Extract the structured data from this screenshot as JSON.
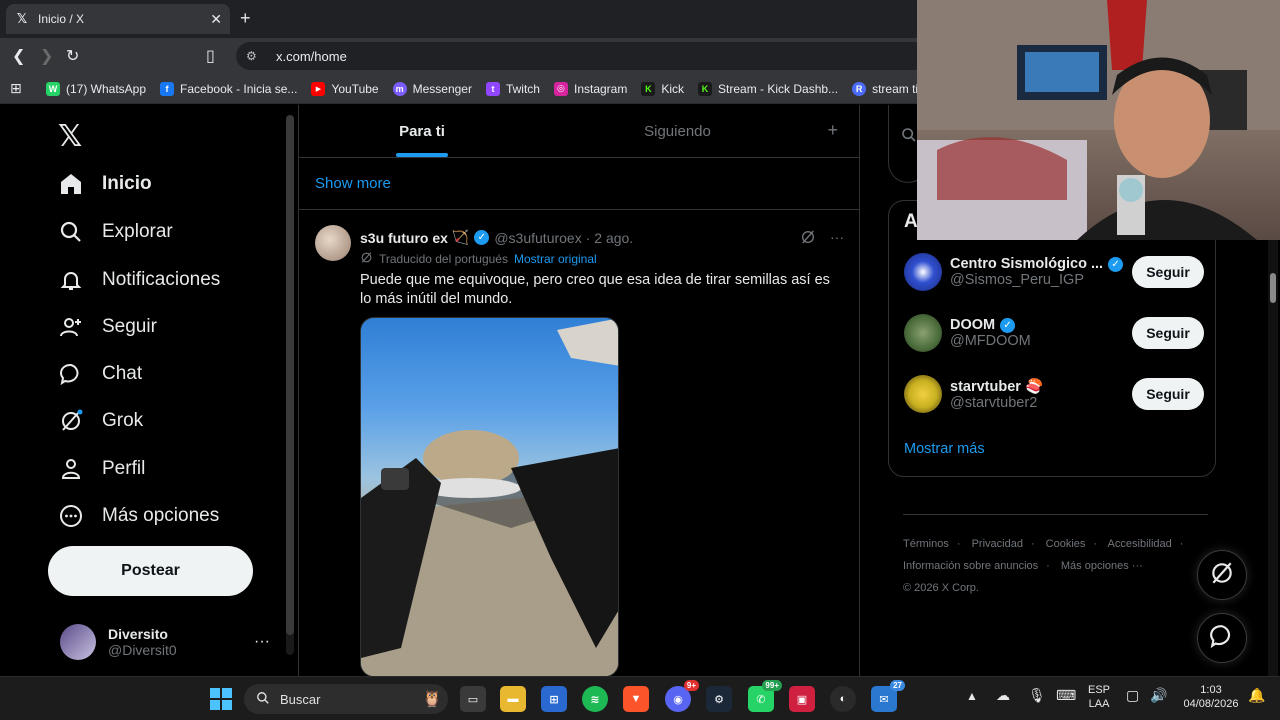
{
  "browser": {
    "tab_title": "Inicio / X",
    "tab_close": "✕",
    "new_tab": "+",
    "url": "x.com/home",
    "bookmarks": [
      {
        "label": "(17) WhatsApp",
        "color": "#25d366",
        "glyph": "W"
      },
      {
        "label": "Facebook - Inicia se...",
        "color": "#1877f2",
        "glyph": "f"
      },
      {
        "label": "YouTube",
        "color": "#ff0000",
        "glyph": "▶"
      },
      {
        "label": "Messenger",
        "color": "#7b5cff",
        "glyph": "m"
      },
      {
        "label": "Twitch",
        "color": "#9146ff",
        "glyph": "t"
      },
      {
        "label": "Instagram",
        "color": "#d6249f",
        "glyph": "◎"
      },
      {
        "label": "Kick",
        "color": "#53fc18",
        "glyph": "K"
      },
      {
        "label": "Stream - Kick Dashb...",
        "color": "#53fc18",
        "glyph": "K"
      },
      {
        "label": "stream tiktok",
        "color": "#4b6bfb",
        "glyph": "R"
      }
    ]
  },
  "nav": {
    "items": [
      {
        "label": "Inicio",
        "icon": "home-icon"
      },
      {
        "label": "Explorar",
        "icon": "search-icon"
      },
      {
        "label": "Notificaciones",
        "icon": "bell-icon"
      },
      {
        "label": "Seguir",
        "icon": "follow-icon"
      },
      {
        "label": "Chat",
        "icon": "chat-icon"
      },
      {
        "label": "Grok",
        "icon": "grok-icon"
      },
      {
        "label": "Perfil",
        "icon": "person-icon"
      },
      {
        "label": "Más opciones",
        "icon": "more-options-icon"
      }
    ],
    "post_button": "Postear",
    "account": {
      "name": "Diversito",
      "handle": "@Diversit0",
      "more": "···"
    }
  },
  "feed": {
    "tabs": [
      "Para ti",
      "Siguiendo"
    ],
    "add_tab": "+",
    "show_more": "Show more",
    "tweet": {
      "name": "s3u futuro ex",
      "emoji": "🏹",
      "handle": "@s3ufuturoex",
      "time": "· 2 ago.",
      "more": "···",
      "translated_label": "Traducido del portugués",
      "show_original": "Mostrar original",
      "text": "Puede que me equivoque, pero creo que esa idea de tirar semillas así es lo más inútil del mundo."
    }
  },
  "right": {
    "card_title": "A",
    "follow_suggestions": [
      {
        "name": "Centro Sismológico ...",
        "handle": "@Sismos_Peru_IGP",
        "verified": true,
        "button": "Seguir",
        "avatar_color": "#2a3fb0"
      },
      {
        "name": "DOOM",
        "handle": "@MFDOOM",
        "verified": true,
        "button": "Seguir",
        "avatar_color": "#4a6b3a"
      },
      {
        "name": "starvtuber 🍣",
        "handle": "@starvtuber2",
        "verified": false,
        "button": "Seguir",
        "avatar_color": "#c8b020"
      }
    ],
    "show_more": "Mostrar más",
    "footer": {
      "line1": [
        "Términos",
        "·",
        "Privacidad",
        "·",
        "Cookies",
        "·",
        "Accesibilidad",
        "·"
      ],
      "line2": [
        "Información sobre anuncios",
        "·",
        "Más opciones ···"
      ],
      "copyright": "© 2026 X Corp."
    }
  },
  "taskbar": {
    "search_label": "Buscar",
    "badges": {
      "discord": "9+",
      "whatsapp": "99+",
      "mail": "27"
    },
    "lang_top": "ESP",
    "lang_bottom": "LAA",
    "time": "1:03",
    "date": "04/08/2026"
  }
}
